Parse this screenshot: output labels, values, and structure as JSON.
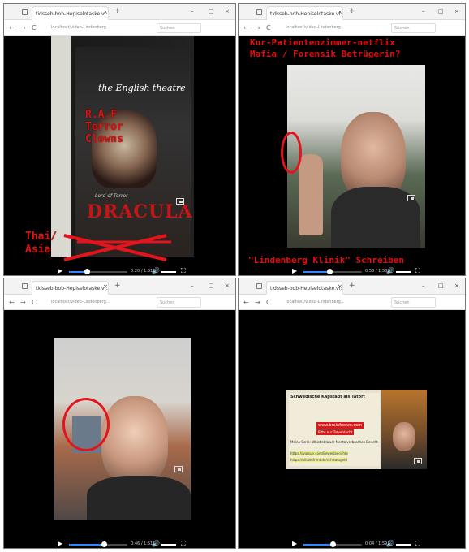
{
  "browser": {
    "tab_title": "tidsseb-bob-Hepiselotaske.vi...",
    "tab_close": "×",
    "new_tab": "+",
    "url": "localhost/video-Lindenberg...",
    "search_placeholder": "Suchen",
    "window_minimize": "–",
    "window_maximize": "□",
    "window_close": "×",
    "nav_back": "←",
    "nav_forward": "→",
    "nav_reload": "C"
  },
  "panels": [
    {
      "overlay_lines": [
        "R.A.F",
        "Terror",
        "Clowns"
      ],
      "bottom_label_lines": [
        "Thai/",
        "Asia"
      ],
      "poster": {
        "brand": "the English theatre",
        "title": "DRACULA",
        "tagline": "Lord of Terror"
      },
      "time": "0:20 / 1:51",
      "progress": 0.3
    },
    {
      "top_lines": [
        "Kur-Patientenzimmer-netflix",
        "Mafia / Forensik Betrügerin?"
      ],
      "bottom_line": "\"Lindenberg Klinik\" Schreiben",
      "time": "0:58 / 1:58",
      "progress": 0.45
    },
    {
      "time": "0:46 / 1:51",
      "progress": 0.6
    },
    {
      "newspaper": {
        "headline": "Schwedische Kapstadt als Tatort",
        "domain": "www.brainfreeze.com",
        "line1": "Bitte nur Tatverdacht",
        "caption": "Meine Serie: Whistleblower Mentalverbrechen Bericht",
        "link_a": "https://ivarsun.com/Beweisberichte",
        "link_b": "https://hlfcoldfront.de/schwarzgeld"
      },
      "time": "0:04 / 1:59",
      "progress": 0.5
    }
  ],
  "controls": {
    "play": "▶",
    "volume": "🔊",
    "fullscreen": "⛶"
  },
  "colors": {
    "overlay_red": "#e01010",
    "progress_blue": "#2f87ff"
  }
}
